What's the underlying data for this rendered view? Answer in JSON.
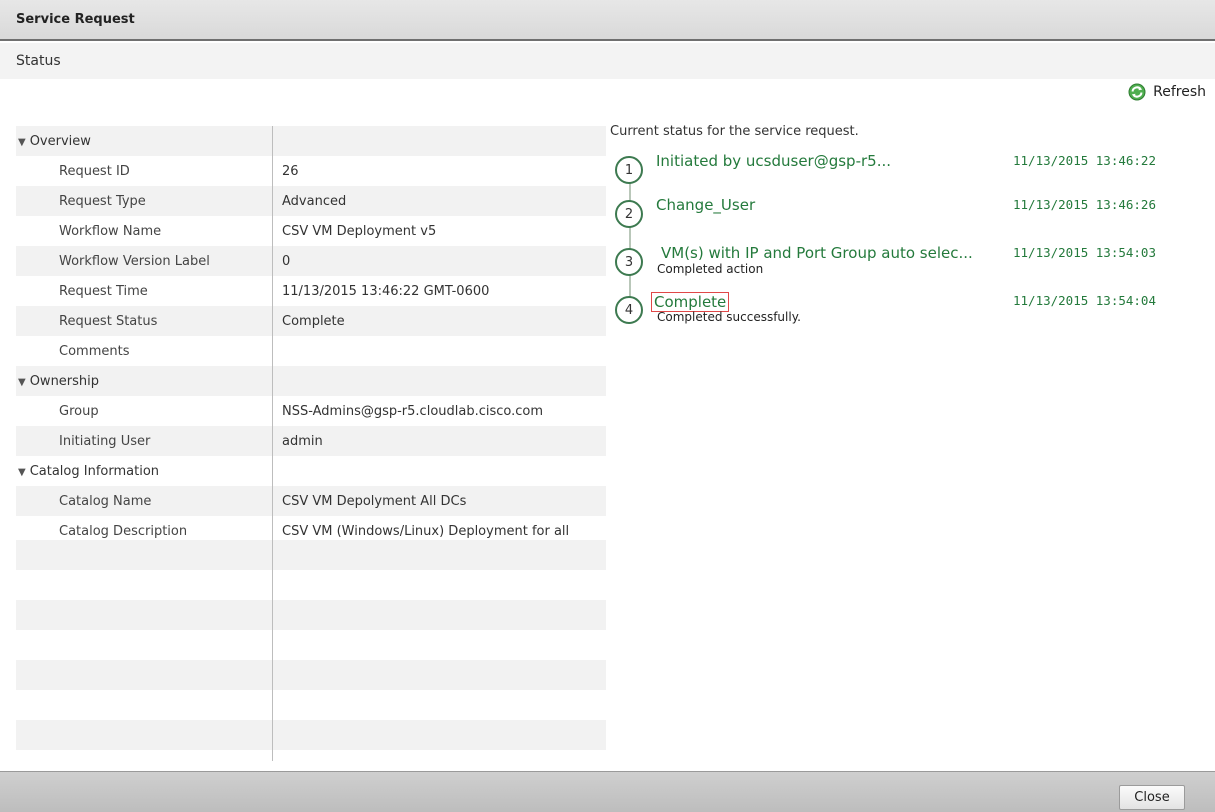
{
  "window": {
    "title": "Service Request"
  },
  "tab": {
    "label": "Status"
  },
  "toolbar": {
    "refresh_label": "Refresh",
    "refresh_icon": "refresh-icon"
  },
  "details": {
    "overview": {
      "header": "Overview",
      "request_id_label": "Request ID",
      "request_id": "26",
      "request_type_label": "Request Type",
      "request_type": "Advanced",
      "workflow_name_label": "Workflow Name",
      "workflow_name": "CSV VM Deployment v5",
      "workflow_version_label_label": "Workflow Version Label",
      "workflow_version_label": "0",
      "request_time_label": "Request Time",
      "request_time": "11/13/2015 13:46:22 GMT-0600",
      "request_status_label": "Request Status",
      "request_status": "Complete",
      "comments_label": "Comments",
      "comments": ""
    },
    "ownership": {
      "header": "Ownership",
      "group_label": "Group",
      "group": "NSS-Admins@gsp-r5.cloudlab.cisco.com",
      "initiating_user_label": "Initiating User",
      "initiating_user": "admin"
    },
    "catalog": {
      "header": "Catalog Information",
      "catalog_name_label": "Catalog Name",
      "catalog_name": "CSV VM Depolyment All DCs",
      "catalog_description_label": "Catalog Description",
      "catalog_description": "CSV VM (Windows/Linux) Deployment for all Data Centers"
    }
  },
  "status": {
    "heading": "Current status for the service request.",
    "steps": [
      {
        "number": "1",
        "name": "Initiated by ucsduser@gsp-r5...",
        "detail": "",
        "time": "11/13/2015 13:46:22"
      },
      {
        "number": "2",
        "name": "Change_User",
        "detail": "",
        "time": "11/13/2015 13:46:26"
      },
      {
        "number": "3",
        "name": "VM(s) with IP and Port Group auto selec...",
        "detail": "Completed action",
        "time": "11/13/2015 13:54:03"
      },
      {
        "number": "4",
        "name": "Complete",
        "detail": "Completed successfully.",
        "time": "11/13/2015 13:54:04"
      }
    ]
  },
  "footer": {
    "close_label": "Close"
  },
  "colors": {
    "accent_green": "#247a3c",
    "highlight_red": "#e04848",
    "header_gray": "#e0e0e0"
  }
}
